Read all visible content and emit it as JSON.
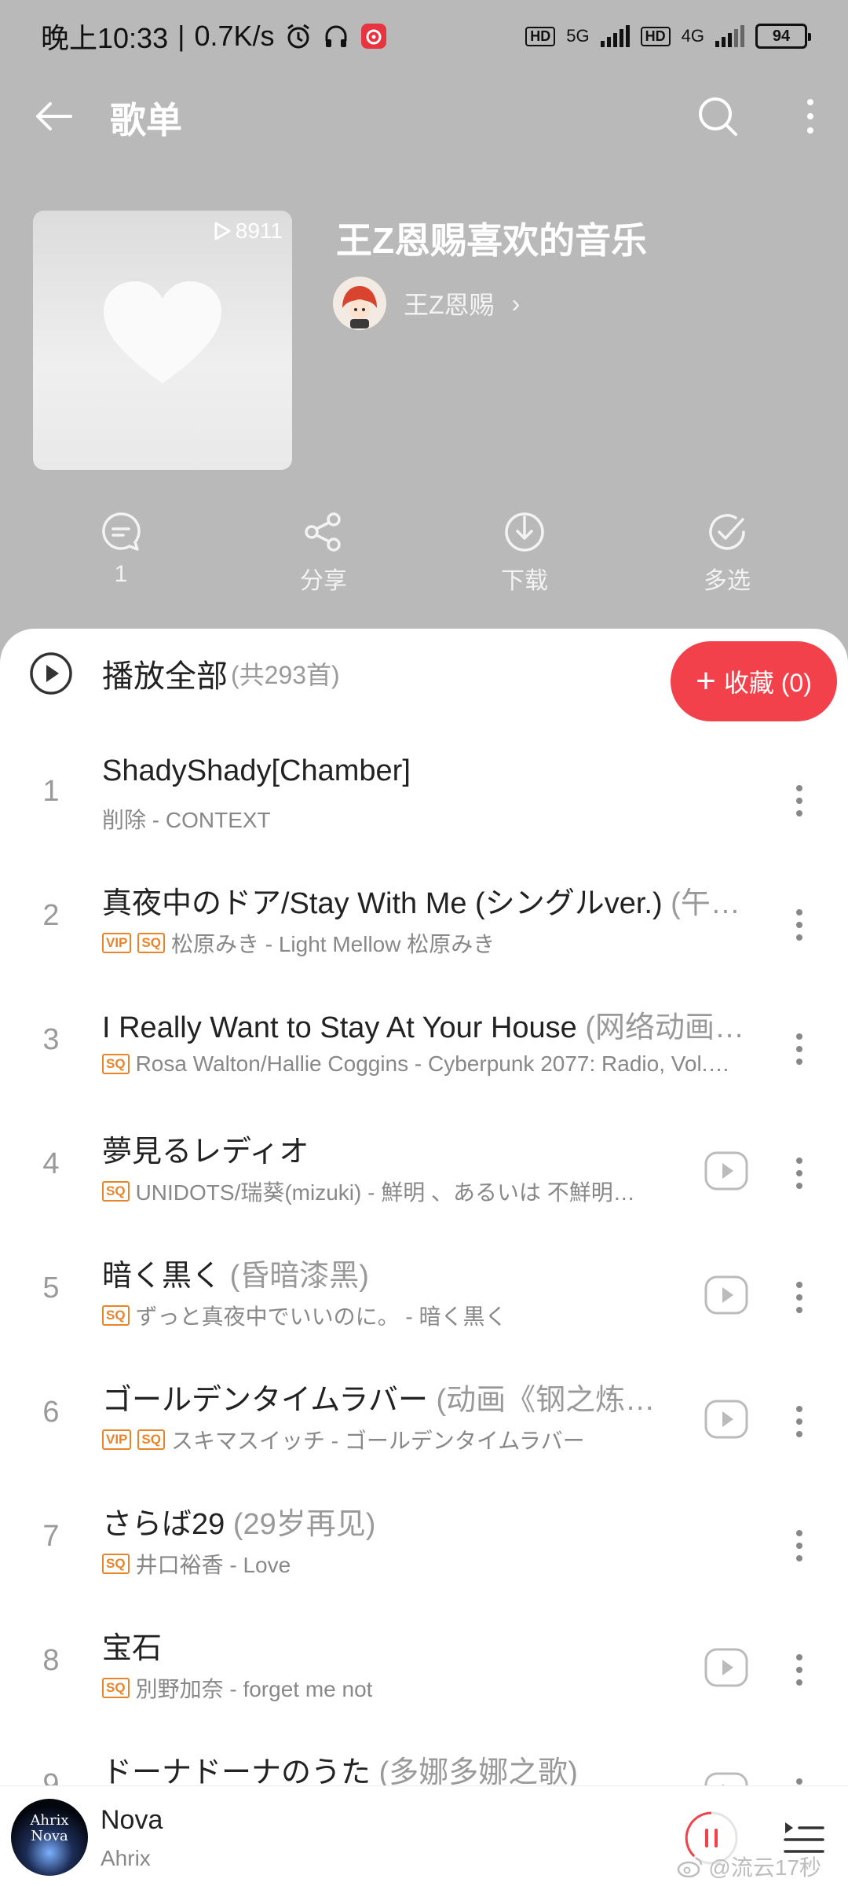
{
  "status_bar": {
    "time": "晚上10:33",
    "speed": "0.7K/s",
    "sim1_type": "5G",
    "sim2_type": "4G",
    "hd": "HD",
    "battery": "94"
  },
  "header": {
    "title": "歌单"
  },
  "playlist": {
    "play_count": "8911",
    "title": "王Z恩赐喜欢的音乐",
    "creator": "王Z恩赐",
    "chevron": "›"
  },
  "actions": {
    "comment": "1",
    "share": "分享",
    "download": "下载",
    "multiselect": "多选"
  },
  "list_header": {
    "play_all": "播放全部",
    "count": "(共293首)",
    "collect_plus": "+",
    "collect": "收藏 (0)"
  },
  "songs": [
    {
      "index": "1",
      "title": "ShadyShady[Chamber]",
      "alias": "",
      "tags": [],
      "meta": "削除 - CONTEXT",
      "mv": false
    },
    {
      "index": "2",
      "title": "真夜中のドア/Stay With Me (シングルver.)",
      "alias": " (午…",
      "tags": [
        "VIP",
        "SQ"
      ],
      "meta": "松原みき - Light Mellow 松原みき",
      "mv": false
    },
    {
      "index": "3",
      "title": "I Really Want to Stay At Your House",
      "alias": " (网络动画…",
      "tags": [
        "SQ"
      ],
      "meta": "Rosa Walton/Hallie Coggins - Cyberpunk 2077: Radio, Vol.…",
      "mv": false
    },
    {
      "index": "4",
      "title": "夢見るレディオ",
      "alias": "",
      "tags": [
        "SQ"
      ],
      "meta": "UNIDOTS/瑞葵(mizuki) - 鮮明 、あるいは 不鮮明…",
      "mv": true
    },
    {
      "index": "5",
      "title": "暗く黒く",
      "alias": " (昏暗漆黑)",
      "tags": [
        "SQ"
      ],
      "meta": "ずっと真夜中でいいのに。 - 暗く黒く",
      "mv": true
    },
    {
      "index": "6",
      "title": "ゴールデンタイムラバー",
      "alias": " (动画《钢之炼…",
      "tags": [
        "VIP",
        "SQ"
      ],
      "meta": "スキマスイッチ - ゴールデンタイムラバー",
      "mv": true
    },
    {
      "index": "7",
      "title": "さらば29",
      "alias": " (29岁再见)",
      "tags": [
        "SQ"
      ],
      "meta": "井口裕香 - Love",
      "mv": false
    },
    {
      "index": "8",
      "title": "宝石",
      "alias": "",
      "tags": [
        "SQ"
      ],
      "meta": "別野加奈 - forget me not",
      "mv": true
    },
    {
      "index": "9",
      "title": "ドーナドーナのうた",
      "alias": " (多娜多娜之歌)",
      "tags": [],
      "meta": "",
      "mv": true
    }
  ],
  "mini_player": {
    "cover_text": "Ahrix Nova",
    "title": "Nova",
    "artist": "Ahrix",
    "watermark": "@流云17秒"
  },
  "colors": {
    "accent": "#f2414a",
    "tag": "#e8852b",
    "header_bg": "#b9b9b9"
  }
}
